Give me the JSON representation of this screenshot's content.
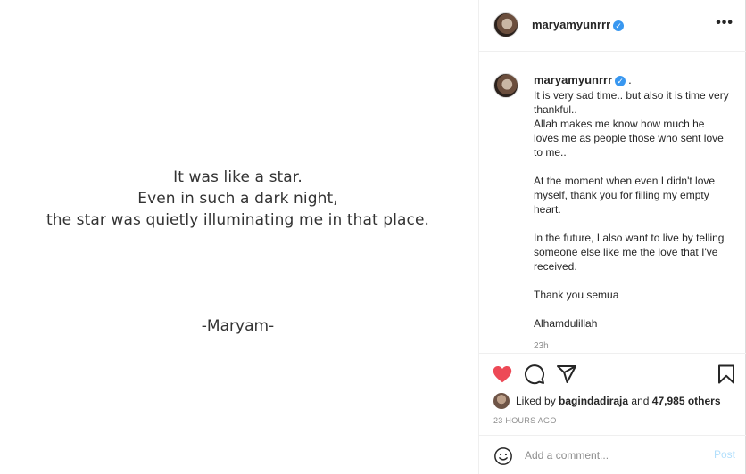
{
  "media": {
    "quote_lines": [
      "It was like a star.",
      "Even in such a dark night,",
      "the star was quietly illuminating me in that place."
    ],
    "signature": "-Maryam-"
  },
  "header": {
    "username": "maryamyunrrr",
    "verified_icon": "verified-badge",
    "more_label": "•••"
  },
  "caption": {
    "username": "maryamyunrrr",
    "suffix": ".",
    "paragraphs": [
      "It is very sad time.. but also it is time very thankful..\nAllah makes me know how much he loves me as people those who sent love to me..",
      "At the moment when even I didn't love myself, thank you for filling my empty heart.",
      "In the future, I also want to live by telling someone else like me the love that I've received.",
      "Thank you semua",
      "Alhamdulillah"
    ],
    "time": "23h"
  },
  "actions": {
    "liked_by_prefix": "Liked by",
    "liked_by_user": "bagindadiraja",
    "and": "and",
    "others_count": "47,985 others",
    "timestamp": "23 HOURS AGO"
  },
  "comment_box": {
    "placeholder": "Add a comment...",
    "post_label": "Post"
  },
  "colors": {
    "like_red": "#ed4956",
    "verified_blue": "#3897f0",
    "post_disabled": "#b2dffc"
  }
}
